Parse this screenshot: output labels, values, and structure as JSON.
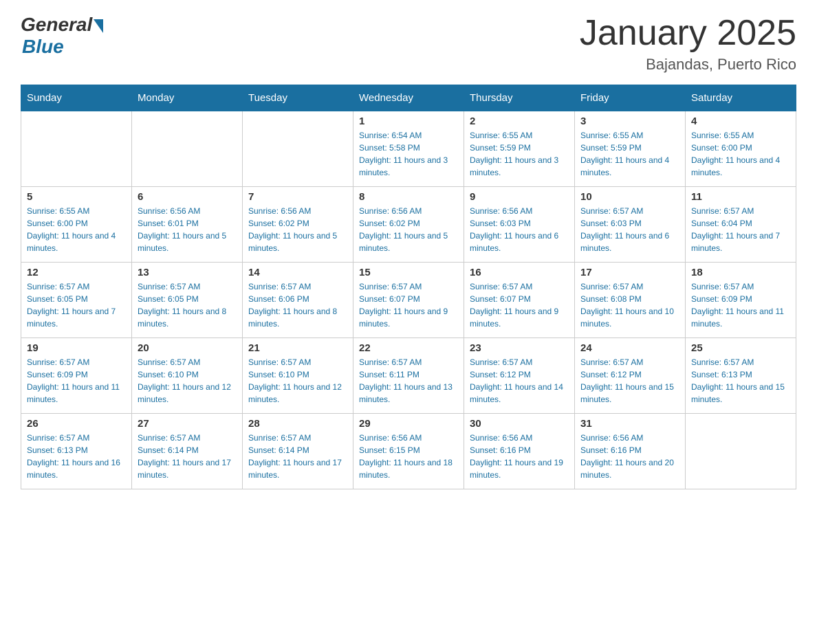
{
  "header": {
    "logo_general": "General",
    "logo_blue": "Blue",
    "month_title": "January 2025",
    "location": "Bajandas, Puerto Rico"
  },
  "weekdays": [
    "Sunday",
    "Monday",
    "Tuesday",
    "Wednesday",
    "Thursday",
    "Friday",
    "Saturday"
  ],
  "weeks": [
    [
      {
        "day": "",
        "info": ""
      },
      {
        "day": "",
        "info": ""
      },
      {
        "day": "",
        "info": ""
      },
      {
        "day": "1",
        "info": "Sunrise: 6:54 AM\nSunset: 5:58 PM\nDaylight: 11 hours and 3 minutes."
      },
      {
        "day": "2",
        "info": "Sunrise: 6:55 AM\nSunset: 5:59 PM\nDaylight: 11 hours and 3 minutes."
      },
      {
        "day": "3",
        "info": "Sunrise: 6:55 AM\nSunset: 5:59 PM\nDaylight: 11 hours and 4 minutes."
      },
      {
        "day": "4",
        "info": "Sunrise: 6:55 AM\nSunset: 6:00 PM\nDaylight: 11 hours and 4 minutes."
      }
    ],
    [
      {
        "day": "5",
        "info": "Sunrise: 6:55 AM\nSunset: 6:00 PM\nDaylight: 11 hours and 4 minutes."
      },
      {
        "day": "6",
        "info": "Sunrise: 6:56 AM\nSunset: 6:01 PM\nDaylight: 11 hours and 5 minutes."
      },
      {
        "day": "7",
        "info": "Sunrise: 6:56 AM\nSunset: 6:02 PM\nDaylight: 11 hours and 5 minutes."
      },
      {
        "day": "8",
        "info": "Sunrise: 6:56 AM\nSunset: 6:02 PM\nDaylight: 11 hours and 5 minutes."
      },
      {
        "day": "9",
        "info": "Sunrise: 6:56 AM\nSunset: 6:03 PM\nDaylight: 11 hours and 6 minutes."
      },
      {
        "day": "10",
        "info": "Sunrise: 6:57 AM\nSunset: 6:03 PM\nDaylight: 11 hours and 6 minutes."
      },
      {
        "day": "11",
        "info": "Sunrise: 6:57 AM\nSunset: 6:04 PM\nDaylight: 11 hours and 7 minutes."
      }
    ],
    [
      {
        "day": "12",
        "info": "Sunrise: 6:57 AM\nSunset: 6:05 PM\nDaylight: 11 hours and 7 minutes."
      },
      {
        "day": "13",
        "info": "Sunrise: 6:57 AM\nSunset: 6:05 PM\nDaylight: 11 hours and 8 minutes."
      },
      {
        "day": "14",
        "info": "Sunrise: 6:57 AM\nSunset: 6:06 PM\nDaylight: 11 hours and 8 minutes."
      },
      {
        "day": "15",
        "info": "Sunrise: 6:57 AM\nSunset: 6:07 PM\nDaylight: 11 hours and 9 minutes."
      },
      {
        "day": "16",
        "info": "Sunrise: 6:57 AM\nSunset: 6:07 PM\nDaylight: 11 hours and 9 minutes."
      },
      {
        "day": "17",
        "info": "Sunrise: 6:57 AM\nSunset: 6:08 PM\nDaylight: 11 hours and 10 minutes."
      },
      {
        "day": "18",
        "info": "Sunrise: 6:57 AM\nSunset: 6:09 PM\nDaylight: 11 hours and 11 minutes."
      }
    ],
    [
      {
        "day": "19",
        "info": "Sunrise: 6:57 AM\nSunset: 6:09 PM\nDaylight: 11 hours and 11 minutes."
      },
      {
        "day": "20",
        "info": "Sunrise: 6:57 AM\nSunset: 6:10 PM\nDaylight: 11 hours and 12 minutes."
      },
      {
        "day": "21",
        "info": "Sunrise: 6:57 AM\nSunset: 6:10 PM\nDaylight: 11 hours and 12 minutes."
      },
      {
        "day": "22",
        "info": "Sunrise: 6:57 AM\nSunset: 6:11 PM\nDaylight: 11 hours and 13 minutes."
      },
      {
        "day": "23",
        "info": "Sunrise: 6:57 AM\nSunset: 6:12 PM\nDaylight: 11 hours and 14 minutes."
      },
      {
        "day": "24",
        "info": "Sunrise: 6:57 AM\nSunset: 6:12 PM\nDaylight: 11 hours and 15 minutes."
      },
      {
        "day": "25",
        "info": "Sunrise: 6:57 AM\nSunset: 6:13 PM\nDaylight: 11 hours and 15 minutes."
      }
    ],
    [
      {
        "day": "26",
        "info": "Sunrise: 6:57 AM\nSunset: 6:13 PM\nDaylight: 11 hours and 16 minutes."
      },
      {
        "day": "27",
        "info": "Sunrise: 6:57 AM\nSunset: 6:14 PM\nDaylight: 11 hours and 17 minutes."
      },
      {
        "day": "28",
        "info": "Sunrise: 6:57 AM\nSunset: 6:14 PM\nDaylight: 11 hours and 17 minutes."
      },
      {
        "day": "29",
        "info": "Sunrise: 6:56 AM\nSunset: 6:15 PM\nDaylight: 11 hours and 18 minutes."
      },
      {
        "day": "30",
        "info": "Sunrise: 6:56 AM\nSunset: 6:16 PM\nDaylight: 11 hours and 19 minutes."
      },
      {
        "day": "31",
        "info": "Sunrise: 6:56 AM\nSunset: 6:16 PM\nDaylight: 11 hours and 20 minutes."
      },
      {
        "day": "",
        "info": ""
      }
    ]
  ]
}
